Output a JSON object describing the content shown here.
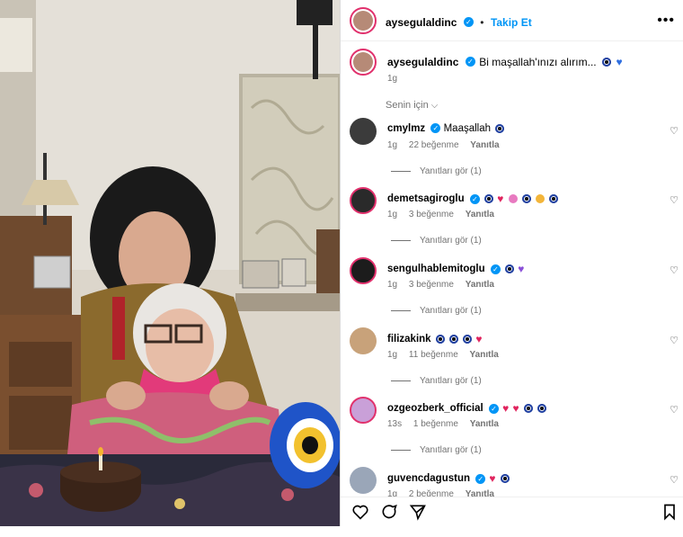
{
  "post": {
    "username": "aysegulaldinc",
    "follow_label": "Takip Et",
    "more_label": "•••"
  },
  "caption": {
    "username": "aysegulaldinc",
    "text": "Bi maşallah'ınızı alırım...",
    "time": "1g"
  },
  "filter_label": "Senin için",
  "comments": [
    {
      "user": "cmylmz",
      "text": "Maaşallah",
      "time": "1g",
      "likes": "22 beğenme",
      "reply": "Yanıtla",
      "replies": "Yanıtları gör (1)",
      "verified": true
    },
    {
      "user": "demetsagiroglu",
      "text": "",
      "time": "1g",
      "likes": "3 beğenme",
      "reply": "Yanıtla",
      "replies": "Yanıtları gör (1)",
      "verified": true
    },
    {
      "user": "sengulhablemitoglu",
      "text": "",
      "time": "1g",
      "likes": "3 beğenme",
      "reply": "Yanıtla",
      "replies": "Yanıtları gör (1)",
      "verified": true
    },
    {
      "user": "filizakink",
      "text": "",
      "time": "1g",
      "likes": "11 beğenme",
      "reply": "Yanıtla",
      "replies": "Yanıtları gör (1)",
      "verified": false
    },
    {
      "user": "ozgeozberk_official",
      "text": "",
      "time": "13s",
      "likes": "1 beğenme",
      "reply": "Yanıtla",
      "replies": "Yanıtları gör (1)",
      "verified": true
    },
    {
      "user": "guvencdagustun",
      "text": "",
      "time": "1g",
      "likes": "2 beğenme",
      "reply": "Yanıtla",
      "replies": "",
      "verified": true
    }
  ],
  "icons": {
    "like": "heart-icon",
    "comment": "comment-icon",
    "share": "send-icon",
    "save": "bookmark-icon",
    "verified": "verified-badge-icon"
  },
  "colors": {
    "accent": "#0095f6",
    "ring": "#e1306c",
    "muted": "#737373"
  }
}
